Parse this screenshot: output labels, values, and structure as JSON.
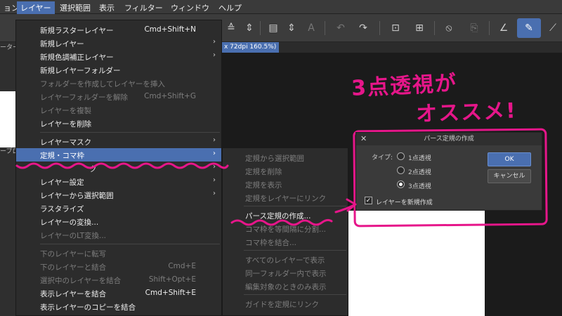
{
  "menubar": {
    "items": [
      {
        "label": "ョン"
      },
      {
        "label": "レイヤー"
      },
      {
        "label": "選択範囲"
      },
      {
        "label": "表示"
      },
      {
        "label": "フィルター"
      },
      {
        "label": "ウィンドウ"
      },
      {
        "label": "ヘルプ"
      }
    ]
  },
  "canvas": {
    "tab_label": "x 72dpi 160.5%)"
  },
  "leftpanel": {
    "label_top": "ーター",
    "label_mid": "ープロ"
  },
  "layer_menu": {
    "items": [
      {
        "label": "新規ラスターレイヤー",
        "shortcut": "Cmd+Shift+N"
      },
      {
        "label": "新規レイヤー",
        "arrow": "›"
      },
      {
        "label": "新規色調補正レイヤー",
        "arrow": "›"
      },
      {
        "label": "新規レイヤーフォルダー"
      },
      {
        "label": "フォルダーを作成してレイヤーを挿入"
      },
      {
        "label": "レイヤーフォルダーを解除",
        "shortcut": "Cmd+Shift+G"
      },
      {
        "label": "レイヤーを複製"
      },
      {
        "label": "レイヤーを削除"
      },
      {
        "label": "レイヤーマスク",
        "arrow": "›"
      },
      {
        "label": "定規・コマ枠",
        "arrow": "›"
      },
      {
        "label": "ク",
        "arrow": "›"
      },
      {
        "label": "レイヤー設定",
        "arrow": "›"
      },
      {
        "label": "レイヤーから選択範囲",
        "arrow": "›"
      },
      {
        "label": "ラスタライズ"
      },
      {
        "label": "レイヤーの変換..."
      },
      {
        "label": "レイヤーのLT変換..."
      },
      {
        "label": "下のレイヤーに転写"
      },
      {
        "label": "下のレイヤーと結合",
        "shortcut": "Cmd+E"
      },
      {
        "label": "選択中のレイヤーを結合",
        "shortcut": "Shift+Opt+E"
      },
      {
        "label": "表示レイヤーを結合",
        "shortcut": "Cmd+Shift+E"
      },
      {
        "label": "表示レイヤーのコピーを結合"
      }
    ]
  },
  "ruler_submenu": {
    "items": [
      {
        "label": "定規から選択範囲"
      },
      {
        "label": "定規を削除"
      },
      {
        "label": "定規を表示"
      },
      {
        "label": "定規をレイヤーにリンク"
      },
      {
        "label": "パース定規の作成..."
      },
      {
        "label": "コマ枠を等間隔に分割..."
      },
      {
        "label": "コマ枠を結合..."
      },
      {
        "label": "すべてのレイヤーで表示"
      },
      {
        "label": "同一フォルダー内で表示"
      },
      {
        "label": "編集対象のときのみ表示"
      },
      {
        "label": "ガイドを定規にリンク"
      }
    ]
  },
  "dialog": {
    "title": "パース定規の作成",
    "close": "✕",
    "type_label": "タイプ:",
    "options": [
      {
        "label": "1点透視",
        "selected": false
      },
      {
        "label": "2点透視",
        "selected": false
      },
      {
        "label": "3点透視",
        "selected": true
      }
    ],
    "checkbox_label": "レイヤーを新規作成",
    "checkbox_checked": true,
    "check_mark": "✓",
    "ok_label": "OK",
    "cancel_label": "キャンセル"
  },
  "annotation": {
    "line1": "3点透視が",
    "line2": "オススメ!",
    "color": "#e6168a"
  },
  "toolbar": {
    "icons": [
      {
        "name": "layer-property-icon",
        "glyph": "≙"
      },
      {
        "name": "stepper-icon",
        "glyph": "⇕"
      },
      {
        "name": "new-layer-icon",
        "glyph": "▤"
      },
      {
        "name": "stepper-icon",
        "glyph": "⇕"
      },
      {
        "name": "text-layer-icon",
        "glyph": "A"
      },
      {
        "name": "undo-icon",
        "glyph": "↶"
      },
      {
        "name": "redo-icon",
        "glyph": "↷"
      },
      {
        "name": "select-all-icon",
        "glyph": "⊡"
      },
      {
        "name": "transform-icon",
        "glyph": "⊞"
      },
      {
        "name": "eraser-icon",
        "glyph": "⦸"
      },
      {
        "name": "paste-icon",
        "glyph": "⎘"
      },
      {
        "name": "ruler-icon",
        "glyph": "∠"
      },
      {
        "name": "brush-icon",
        "glyph": "✎"
      },
      {
        "name": "pen-icon",
        "glyph": "⟋"
      }
    ]
  }
}
